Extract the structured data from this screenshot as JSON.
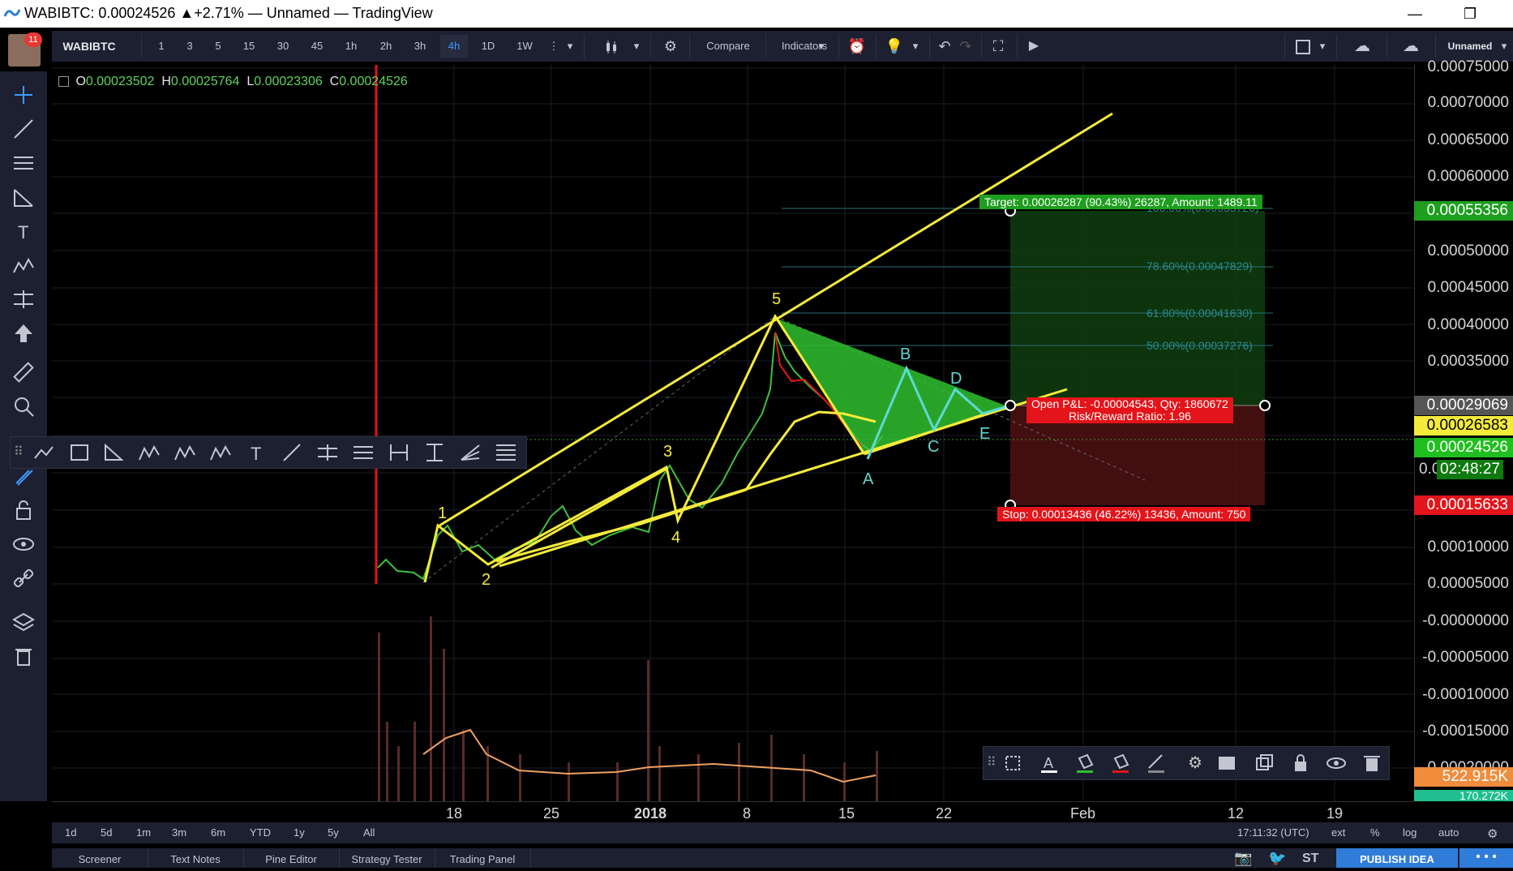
{
  "window": {
    "title": "WABIBTC: 0.00024526 ▲+2.71% — Unnamed — TradingView"
  },
  "user": {
    "notifications": "11"
  },
  "toolbar": {
    "symbol": "WABIBTC",
    "intervals": [
      "1",
      "3",
      "5",
      "15",
      "30",
      "45",
      "1h",
      "2h",
      "3h",
      "4h",
      "1D",
      "1W"
    ],
    "active_interval": "4h",
    "compare_label": "Compare",
    "indicators_label": "Indicators",
    "layout_name": "Unnamed"
  },
  "ohlc": {
    "o_label": "O",
    "o": "0.00023502",
    "h_label": "H",
    "h": "0.00025764",
    "l_label": "L",
    "l": "0.00023306",
    "c_label": "C",
    "c": "0.00024526"
  },
  "price_scale": {
    "ticks": [
      "0.00075000",
      "0.00070000",
      "0.00065000",
      "0.00060000",
      "0.00050000",
      "0.00045000",
      "0.00040000",
      "0.00035000",
      "0.00010000",
      "0.00005000",
      "-0.00000000",
      "-0.00005000",
      "-0.00010000",
      "-0.00015000",
      "-0.00020000"
    ],
    "badges": {
      "target": "0.00055356",
      "pl": "0.00029069",
      "yellow": "0.00026583",
      "last": "0.00024526",
      "last_prefix": "0.0",
      "countdown": "02:48:27",
      "stop": "0.00015633",
      "volume": "522.915K",
      "volume2": "170.272K"
    }
  },
  "time_axis": {
    "labels": [
      "18",
      "25",
      "2018",
      "8",
      "15",
      "22",
      "Feb",
      "12",
      "19"
    ]
  },
  "range_bar": {
    "ranges": [
      "1d",
      "5d",
      "1m",
      "3m",
      "6m",
      "YTD",
      "1y",
      "5y",
      "All"
    ],
    "clock": "17:11:32 (UTC)",
    "options": [
      "ext",
      "%",
      "log",
      "auto"
    ]
  },
  "bottom_tabs": [
    "Screener",
    "Text Notes",
    "Pine Editor",
    "Strategy Tester",
    "Trading Panel"
  ],
  "publish_label": "PUBLISH IDEA",
  "annotations": {
    "target_label": "Target: 0.00026287 (90.43%) 26287, Amount: 1489.11",
    "stop_label": "Stop: 0.00013436 (46.22%) 13436, Amount: 750",
    "pl_label_1": "Open P&L: -0.00004543, Qty: 1860672",
    "pl_label_2": "Risk/Reward Ratio: 1.96",
    "fib_100": "100.00%(0.00055726)",
    "fib_786": "78.60%(0.00047829)",
    "fib_618": "61.80%(0.00041630)",
    "fib_50": "50.00%(0.00037276)",
    "waves": [
      "1",
      "2",
      "3",
      "4",
      "5"
    ],
    "abcde": [
      "A",
      "B",
      "C",
      "D",
      "E"
    ]
  },
  "colors": {
    "yellow": "#f5eb3b",
    "green": "#2e9e2e",
    "red": "#e3141a",
    "cyan": "#5fd9d3",
    "toolbar_bg": "#1c2030",
    "accent": "#3e9bff"
  },
  "chart_data": {
    "type": "line",
    "title": "",
    "xlabel": "",
    "ylabel": "",
    "ylim": [
      -0.0002,
      0.00075
    ],
    "x": [
      "18",
      "25",
      "2018",
      "8",
      "15",
      "22"
    ],
    "series": [
      {
        "name": "",
        "values": [
          0.0001,
          0.00013,
          0.00016,
          0.00041,
          0.00025,
          0.000245
        ]
      }
    ]
  }
}
